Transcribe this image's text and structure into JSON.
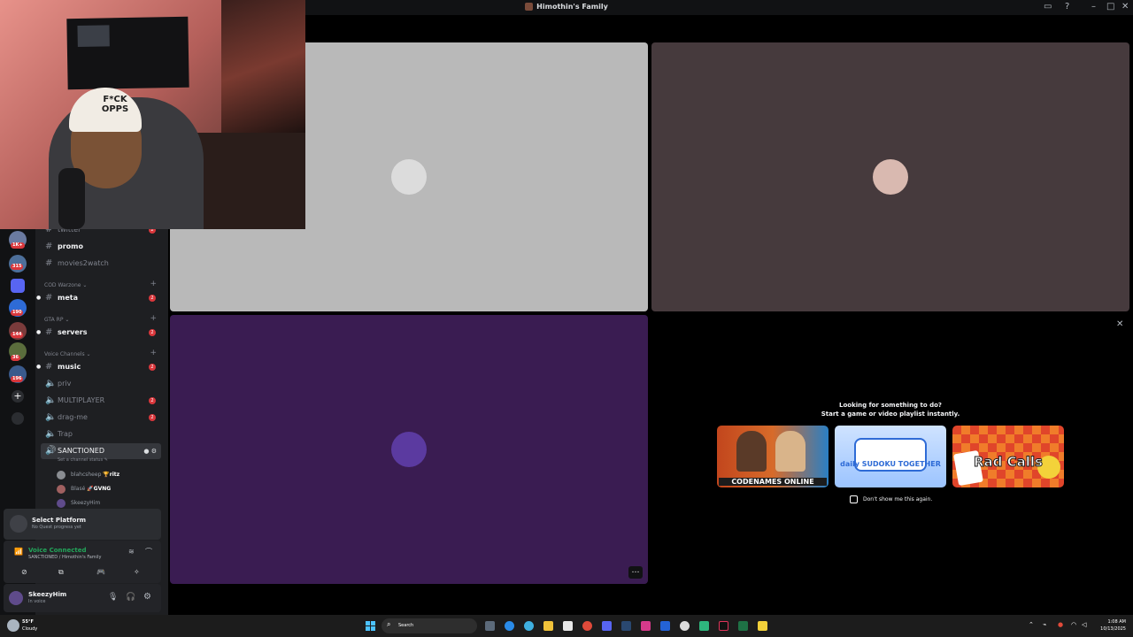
{
  "window": {
    "title": "Himothin's Family"
  },
  "guilds": {
    "badges": [
      "1K+",
      "315",
      "190",
      "144",
      "36",
      "196"
    ]
  },
  "channels": {
    "text_channels": [
      {
        "name": "twitter",
        "count": "2"
      },
      {
        "name": "promo",
        "count": ""
      },
      {
        "name": "movies2watch",
        "count": ""
      }
    ],
    "categories": [
      {
        "name": "COD Warzone",
        "channel": "meta",
        "count": "2"
      },
      {
        "name": "GTA RP",
        "channel": "servers",
        "count": "2"
      },
      {
        "name": "Voice Channels",
        "channel": "music",
        "count": "2"
      }
    ],
    "voice_channels": [
      {
        "name": "priv",
        "count": ""
      },
      {
        "name": "MULTIPLAYER",
        "count": "2"
      },
      {
        "name": "drag-me",
        "count": "2"
      },
      {
        "name": "Trap",
        "count": ""
      }
    ],
    "active_voice": {
      "name": "SANCTIONED",
      "status": "Set a channel status",
      "users": [
        {
          "name": "blahcsheep",
          "tag": "🏆ritz"
        },
        {
          "name": "Blasé",
          "tag": "🚀GVNG"
        },
        {
          "name": "SkeezyHim",
          "tag": ""
        }
      ]
    }
  },
  "quest": {
    "title": "Select Platform",
    "subtitle": "No Quest progress yet"
  },
  "voice": {
    "status": "Voice Connected",
    "location": "SANCTIONED / Himothin's Family"
  },
  "user": {
    "name": "SkeezyHim",
    "status": "In voice"
  },
  "camera": {
    "cap_text": "F*CK OPPS"
  },
  "tiles": {
    "colors": {
      "tile1": "#b9b9b9",
      "tile2": "#463a3d",
      "tile3": "#3a1c52"
    }
  },
  "activity": {
    "line1": "Looking for something to do?",
    "line2": "Start a game or video playlist instantly.",
    "games": [
      {
        "name": "CODENAMES ONLINE"
      },
      {
        "name": "daily SUDOKU TOGETHER"
      },
      {
        "name": "Rad Calls"
      }
    ],
    "dont_show": "Don't show me this again."
  },
  "taskbar": {
    "weather_temp": "55°F",
    "weather_desc": "Cloudy",
    "search": "Search",
    "time": "1:08 AM",
    "date": "10/13/2025"
  }
}
